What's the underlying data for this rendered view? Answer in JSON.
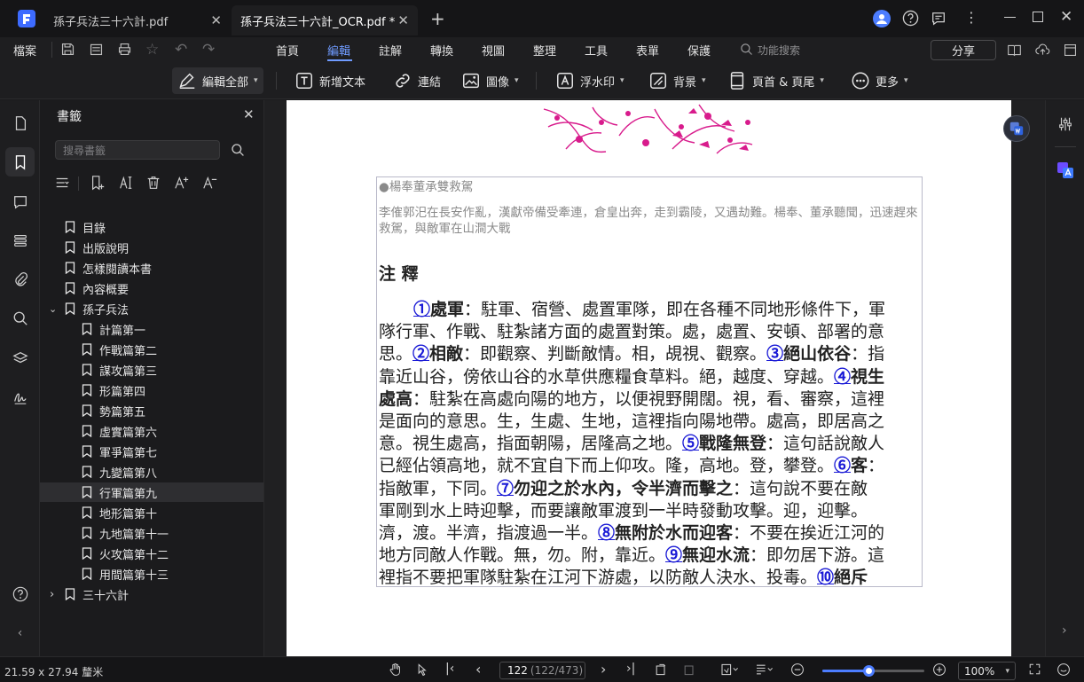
{
  "titlebar": {
    "tabs": [
      {
        "label": "孫子兵法三十六計.pdf",
        "active": false
      },
      {
        "label": "孫子兵法三十六計_OCR.pdf *",
        "active": true
      }
    ],
    "new_tab": "+"
  },
  "menubar": {
    "file": "檔案",
    "tabs": [
      "首頁",
      "編輯",
      "註解",
      "轉換",
      "視圖",
      "整理",
      "工具",
      "表單",
      "保護"
    ],
    "active_tab": "編輯",
    "search_placeholder": "功能搜索",
    "share": "分享"
  },
  "toolbar": {
    "edit_all": "編輯全部",
    "add_text": "新增文本",
    "link": "連結",
    "image": "圖像",
    "watermark": "浮水印",
    "background": "背景",
    "header_footer": "頁首 & 頁尾",
    "more": "更多"
  },
  "panel": {
    "title": "書籤",
    "search_placeholder": "搜尋書籤",
    "bookmarks": [
      {
        "label": "目錄",
        "level": 0
      },
      {
        "label": "出版說明",
        "level": 0
      },
      {
        "label": "怎樣閱讀本書",
        "level": 0
      },
      {
        "label": "內容概要",
        "level": 0
      },
      {
        "label": "孫子兵法",
        "level": 0,
        "expanded": true
      },
      {
        "label": "計篇第一",
        "level": 1
      },
      {
        "label": "作戰篇第二",
        "level": 1
      },
      {
        "label": "謀攻篇第三",
        "level": 1
      },
      {
        "label": "形篇第四",
        "level": 1
      },
      {
        "label": "勢篇第五",
        "level": 1
      },
      {
        "label": "虛實篇第六",
        "level": 1
      },
      {
        "label": "軍爭篇第七",
        "level": 1
      },
      {
        "label": "九變篇第八",
        "level": 1
      },
      {
        "label": "行軍篇第九",
        "level": 1,
        "selected": true
      },
      {
        "label": "地形篇第十",
        "level": 1
      },
      {
        "label": "九地篇第十一",
        "level": 1
      },
      {
        "label": "火攻篇第十二",
        "level": 1
      },
      {
        "label": "用間篇第十三",
        "level": 1
      },
      {
        "label": "三十六計",
        "level": 0,
        "collapsed": true
      }
    ]
  },
  "document": {
    "caption_title": "●楊奉董承雙救駕",
    "caption_body": "李傕郭汜在長安作亂，漢獻帝備受牽連，倉皇出奔，走到霸陵，又遇劫難。楊奉、董承聽聞，迅速趕來救駕，與敵軍在山澗大戰",
    "heading": "注 釋",
    "lines": [
      [
        [
          "a",
          "①"
        ],
        [
          "t",
          "處軍"
        ],
        [
          "n",
          "：駐軍、宿營、處置軍隊，即在各種不同地形條件下，軍"
        ]
      ],
      [
        [
          "n",
          "隊行軍、作戰、駐紮諸方面的處置對策。處，處置、安頓、部署的意"
        ]
      ],
      [
        [
          "n",
          "思。"
        ],
        [
          "a",
          "②"
        ],
        [
          "t",
          "相敵"
        ],
        [
          "n",
          "：即觀察、判斷敵情。相，覘視、觀察。"
        ],
        [
          "a",
          "③"
        ],
        [
          "t",
          "絕山依谷"
        ],
        [
          "n",
          "：指"
        ]
      ],
      [
        [
          "n",
          "靠近山谷，傍依山谷的水草供應糧食草料。絕，越度、穿越。"
        ],
        [
          "a",
          "④"
        ],
        [
          "t",
          "視生"
        ]
      ],
      [
        [
          "t",
          "處高"
        ],
        [
          "n",
          "：駐紮在高處向陽的地方，以便視野開闊。視，看、審察，這裡"
        ]
      ],
      [
        [
          "n",
          "是面向的意思。生，生處、生地，這裡指向陽地帶。處高，即居高之"
        ]
      ],
      [
        [
          "n",
          "意。視生處高，指面朝陽，居隆高之地。"
        ],
        [
          "a",
          "⑤"
        ],
        [
          "t",
          "戰隆無登"
        ],
        [
          "n",
          "：這句話說敵人"
        ]
      ],
      [
        [
          "n",
          "已經佔領高地，就不宜自下而上仰攻。隆，高地。登，攀登。"
        ],
        [
          "a",
          "⑥"
        ],
        [
          "t",
          "客"
        ],
        [
          "n",
          "："
        ]
      ],
      [
        [
          "n",
          "指敵軍，下同。"
        ],
        [
          "a",
          "⑦"
        ],
        [
          "t",
          "勿迎之於水內，令半濟而擊之"
        ],
        [
          "n",
          "：這句說不要在敵"
        ]
      ],
      [
        [
          "n",
          "軍剛到水上時迎擊，而要讓敵軍渡到一半時發動攻擊。迎，迎擊。"
        ]
      ],
      [
        [
          "n",
          "濟，渡。半濟，指渡過一半。"
        ],
        [
          "a",
          "⑧"
        ],
        [
          "t",
          "無附於水而迎客"
        ],
        [
          "n",
          "：不要在挨近江河的"
        ]
      ],
      [
        [
          "n",
          "地方同敵人作戰。無，勿。附，靠近。"
        ],
        [
          "a",
          "⑨"
        ],
        [
          "t",
          "無迎水流"
        ],
        [
          "n",
          "：即勿居下游。這"
        ]
      ],
      [
        [
          "n",
          "裡指不要把軍隊駐紮在江河下游處，以防敵人決水、投毒。"
        ],
        [
          "a",
          "⑩"
        ],
        [
          "t",
          "絕斥"
        ]
      ]
    ]
  },
  "status": {
    "page_size": "21.59 x 27.94 釐米",
    "page_current": "122",
    "page_total": "(122/473)",
    "zoom": "100%",
    "zoom_fraction": 0.45
  },
  "colors": {
    "accent": "#4c7dff",
    "bg": "#1b1b1d",
    "annotation": "#1a1ad6",
    "illustration": "#d81b8c"
  }
}
